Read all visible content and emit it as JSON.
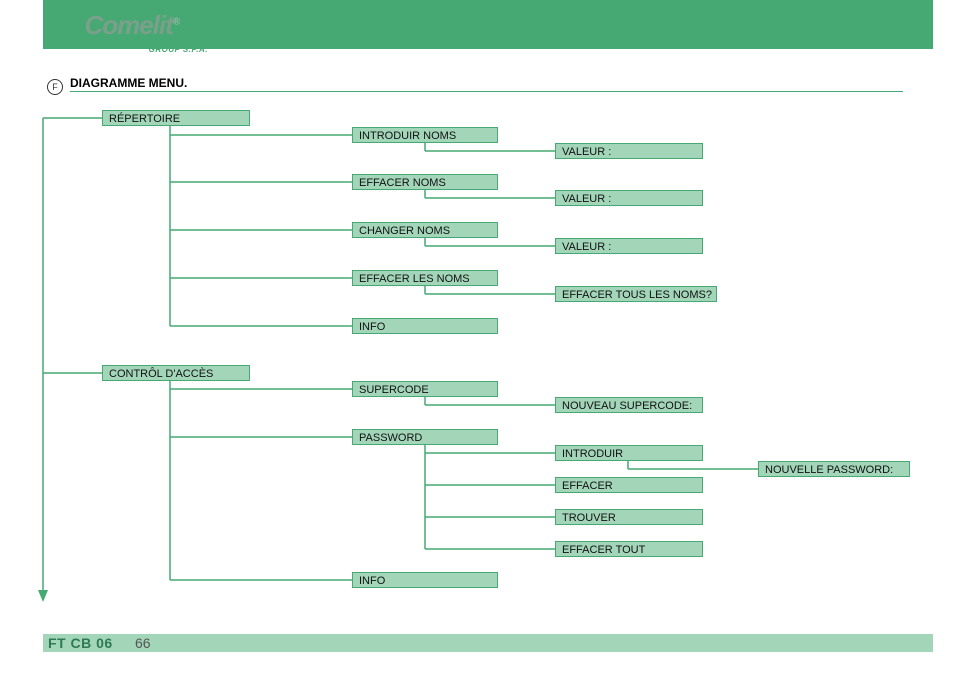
{
  "brand": {
    "name": "Comelit",
    "sub": "GROUP S.P.A."
  },
  "lang_marker": "F",
  "section_title": "DIAGRAMME MENU.",
  "footer": {
    "code": "FT CB 06",
    "page": "66"
  },
  "nodes": {
    "repertoire": "RÉPERTOIRE",
    "introduir_noms": "INTRODUIR NOMS",
    "valeur1": "VALEUR :",
    "effacer_noms": "EFFACER NOMS",
    "valeur2": "VALEUR :",
    "changer_noms": "CHANGER NOMS",
    "valeur3": "VALEUR :",
    "effacer_les_noms": "EFFACER LES NOMS",
    "effacer_tous": "EFFACER TOUS LES NOMS?",
    "info1": "INFO",
    "control_acces": "CONTRÔL D'ACCÈS",
    "supercode": "SUPERCODE",
    "nouveau_supercode": "NOUVEAU SUPERCODE:",
    "password": "PASSWORD",
    "introduir": "INTRODUIR",
    "nouvelle_password": "NOUVELLE PASSWORD:",
    "effacer": "EFFACER",
    "trouver": "TROUVER",
    "effacer_tout": "EFFACER TOUT",
    "info2": "INFO"
  }
}
